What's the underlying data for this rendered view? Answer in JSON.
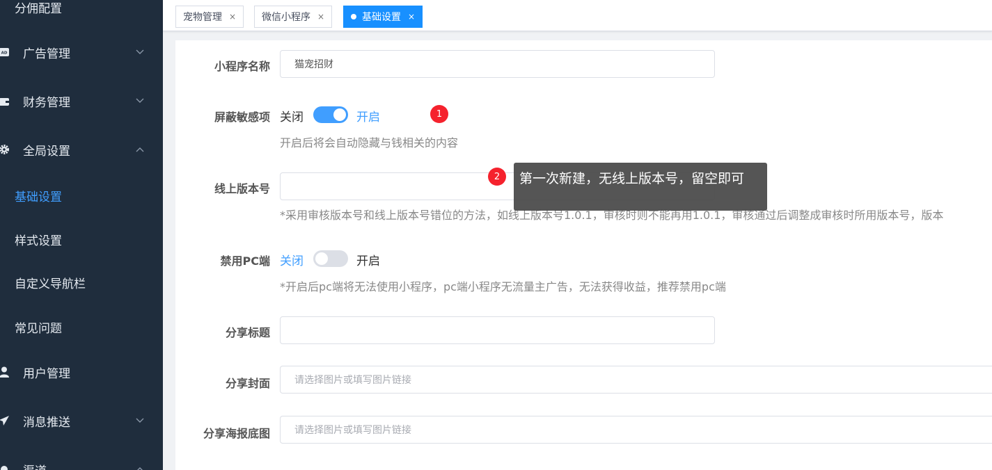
{
  "sidebar": {
    "items": [
      {
        "label": "分佣配置",
        "icon": "none"
      },
      {
        "label": "广告管理",
        "icon": "ad-icon"
      },
      {
        "label": "财务管理",
        "icon": "wallet-icon"
      },
      {
        "label": "全局设置",
        "icon": "gear-icon"
      },
      {
        "label": "用户管理",
        "icon": "user-icon"
      },
      {
        "label": "消息推送",
        "icon": "send-icon"
      },
      {
        "label": "渠道",
        "icon": "channel-icon"
      }
    ],
    "subitems": [
      {
        "label": "基础设置"
      },
      {
        "label": "样式设置"
      },
      {
        "label": "自定义导航栏"
      },
      {
        "label": "常见问题"
      }
    ]
  },
  "tabs": [
    {
      "label": "宠物管理",
      "close": "×"
    },
    {
      "label": "微信小程序",
      "close": "×"
    },
    {
      "label": "基础设置",
      "close": "×"
    }
  ],
  "form": {
    "name_label": "小程序名称",
    "name_value": "猫宠招财",
    "sensitive_label": "屏蔽敏感项",
    "sensitive_off": "关闭",
    "sensitive_on": "开启",
    "sensitive_hint": "开启后将会自动隐藏与钱相关的内容",
    "version_label": "线上版本号",
    "version_value": "",
    "version_hint": "*采用审核版本号和线上版本号错位的方法，如线上版本号1.0.1，审核时则不能再用1.0.1，审核通过后调整成审核时所用版本号，版本",
    "pc_label": "禁用PC端",
    "pc_off": "关闭",
    "pc_on": "开启",
    "pc_hint": "*开启后pc端将无法使用小程序，pc端小程序无流量主广告，无法获得收益，推荐禁用pc端",
    "share_title_label": "分享标题",
    "share_title_value": "",
    "share_cover_label": "分享封面",
    "share_cover_placeholder": "请选择图片或填写图片链接",
    "share_poster_label": "分享海报底图",
    "share_poster_placeholder": "请选择图片或填写图片链接"
  },
  "badges": {
    "one": "1",
    "two": "2"
  },
  "tooltip": {
    "text": "第一次新建，无线上版本号，留空即可"
  },
  "state": {
    "sensitive_enabled": true,
    "pc_disabled": false
  },
  "colors": {
    "primary": "#409eff",
    "tab_active": "#1890ff",
    "sidebar_bg": "#1f2d3d",
    "badge": "#f5222d"
  }
}
